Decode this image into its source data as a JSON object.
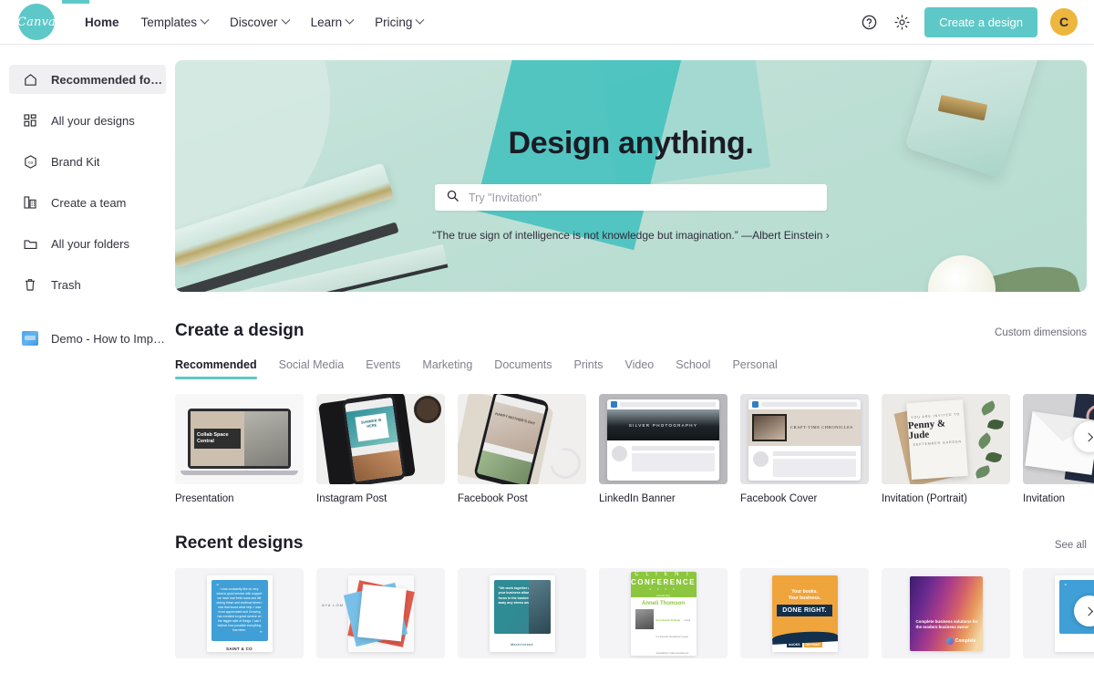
{
  "topnav": {
    "logo_text": "Canva",
    "links": [
      {
        "label": "Home",
        "has_caret": false,
        "active": true
      },
      {
        "label": "Templates",
        "has_caret": true,
        "active": false
      },
      {
        "label": "Discover",
        "has_caret": true,
        "active": false
      },
      {
        "label": "Learn",
        "has_caret": true,
        "active": false
      },
      {
        "label": "Pricing",
        "has_caret": true,
        "active": false
      }
    ],
    "help_icon": "help-circle-icon",
    "settings_icon": "gear-icon",
    "cta_label": "Create a design",
    "avatar_initial": "C",
    "accent_color": "#5ec8c8",
    "avatar_color": "#edb63c"
  },
  "sidebar": {
    "items": [
      {
        "label": "Recommended for you",
        "icon": "home-icon",
        "active": true
      },
      {
        "label": "All your designs",
        "icon": "grid-icon",
        "active": false
      },
      {
        "label": "Brand Kit",
        "icon": "brand-hexagon-icon",
        "active": false
      },
      {
        "label": "Create a team",
        "icon": "building-icon",
        "active": false
      },
      {
        "label": "All your folders",
        "icon": "folder-icon",
        "active": false
      },
      {
        "label": "Trash",
        "icon": "trash-icon",
        "active": false
      }
    ],
    "pinned": {
      "label": "Demo - How to Improve C...",
      "icon": "design-thumbnail-icon"
    }
  },
  "hero": {
    "title": "Design anything.",
    "search_placeholder": "Try \"Invitation\"",
    "search_value": "",
    "search_icon": "search-icon",
    "quote": "“The true sign of intelligence is not knowledge but imagination.” —Albert Einstein ›"
  },
  "create_section": {
    "title": "Create a design",
    "custom_link": "Custom dimensions",
    "tabs": [
      {
        "label": "Recommended",
        "active": true
      },
      {
        "label": "Social Media",
        "active": false
      },
      {
        "label": "Events",
        "active": false
      },
      {
        "label": "Marketing",
        "active": false
      },
      {
        "label": "Documents",
        "active": false
      },
      {
        "label": "Prints",
        "active": false
      },
      {
        "label": "Video",
        "active": false
      },
      {
        "label": "School",
        "active": false
      },
      {
        "label": "Personal",
        "active": false
      }
    ],
    "cards": [
      {
        "label": "Presentation",
        "art": "Collab Space Central"
      },
      {
        "label": "Instagram Post",
        "art": "SUMMER IS HERE"
      },
      {
        "label": "Facebook Post",
        "art": "HAPPY MOTHER'S DAY"
      },
      {
        "label": "LinkedIn Banner",
        "art": "SILVER PHOTOGRAPHY"
      },
      {
        "label": "Facebook Cover",
        "art": "CRAFT-TIME CHRONICLES"
      },
      {
        "label": "Invitation (Portrait)",
        "art": "Penny & Jude"
      },
      {
        "label": "Invitation",
        "art": "envelope"
      }
    ],
    "next_icon": "chevron-right-icon"
  },
  "recent_section": {
    "title": "Recent designs",
    "see_all_link": "See all",
    "cards": [
      {
        "art": "quote-blue",
        "brand": "SAINT & CO",
        "quote": "I was constantly like so very what is good service with support we have had fresh bank and life during these and continue times I now that boost what help. I was most appreciated and Growing has enrolled so great service on the bigger side of things. I can't believe how possible everything has been."
      },
      {
        "art": "polaroid",
        "brand": "AYA LOM"
      },
      {
        "art": "quote-teal",
        "quote": "\"We work together and grow your business allowing you to focus in the business taking away any stress and hassle\"",
        "brand": "Masterbrand"
      },
      {
        "art": "conference",
        "title1": "C L I E N T",
        "title2": "CONFERENCE",
        "year": "2 0 2 0",
        "intro": "introducing",
        "name": "Anneli Thomson",
        "role": "Kore Gender Training",
        "body": "Anneli is a business development expert specialising in sales development, growth and performance coaching."
      },
      {
        "art": "books",
        "line1": "Your books.",
        "line2": "Your business.",
        "badge": "DONE RIGHT.",
        "brand1": "BOOKS",
        "brand2": "ON POINT"
      },
      {
        "art": "gradient",
        "text": "Complete business solutions for the modern business owner",
        "brand": "Complete"
      },
      {
        "art": "quote-blue-partial",
        "brand": ""
      }
    ],
    "next_icon": "chevron-right-icon"
  }
}
